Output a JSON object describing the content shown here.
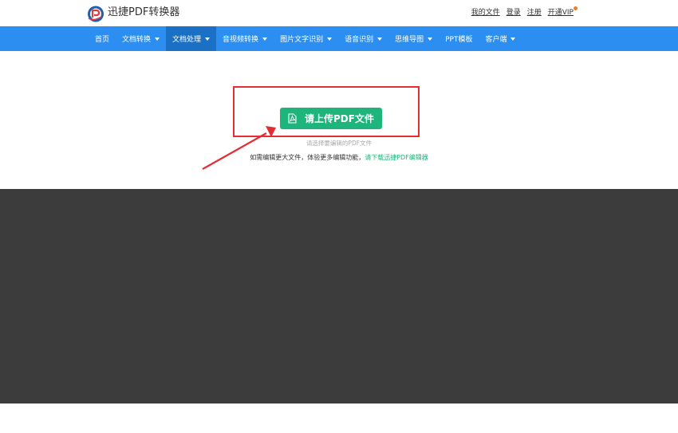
{
  "header": {
    "brand": "迅捷PDF转换器",
    "links": [
      "我的文件",
      "登录",
      "注册"
    ],
    "vip": "开通VIP"
  },
  "nav": {
    "items": [
      {
        "label": "首页",
        "dropdown": false,
        "active": false
      },
      {
        "label": "文档转换",
        "dropdown": true,
        "active": false
      },
      {
        "label": "文档处理",
        "dropdown": true,
        "active": true
      },
      {
        "label": "音视频转换",
        "dropdown": true,
        "active": false
      },
      {
        "label": "图片文字识别",
        "dropdown": true,
        "active": false
      },
      {
        "label": "语音识别",
        "dropdown": true,
        "active": false
      },
      {
        "label": "思维导图",
        "dropdown": true,
        "active": false
      },
      {
        "label": "PPT模板",
        "dropdown": false,
        "active": false
      },
      {
        "label": "客户端",
        "dropdown": true,
        "active": false
      }
    ]
  },
  "upload": {
    "button": "请上传PDF文件",
    "hint": "请选择要编辑的PDF文件",
    "note": "如需编辑更大文件，体验更多编辑功能，",
    "download_link": "请下载迅捷PDF编辑器"
  },
  "colors": {
    "nav": "#2b8ef0",
    "nav_active": "#1970c5",
    "button": "#1db57c",
    "highlight": "#e42d33",
    "dark_panel": "#3c3c3c"
  }
}
